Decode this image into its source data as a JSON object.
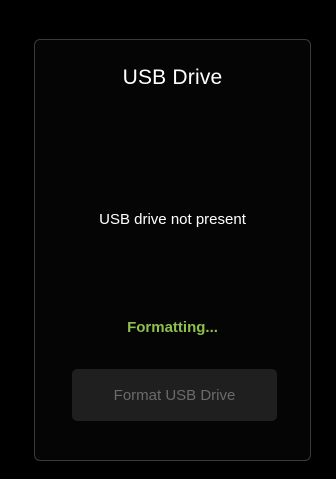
{
  "panel": {
    "title": "USB Drive",
    "status": "USB drive not present",
    "progress": "Formatting...",
    "format_button_label": "Format USB Drive",
    "format_button_enabled": false
  },
  "colors": {
    "background": "#000000",
    "panel_border": "#3a3a3a",
    "title_text": "#ffffff",
    "progress_text": "#8fbf4d",
    "button_bg": "#1f1f1f",
    "button_text_disabled": "#6b6b6b"
  }
}
